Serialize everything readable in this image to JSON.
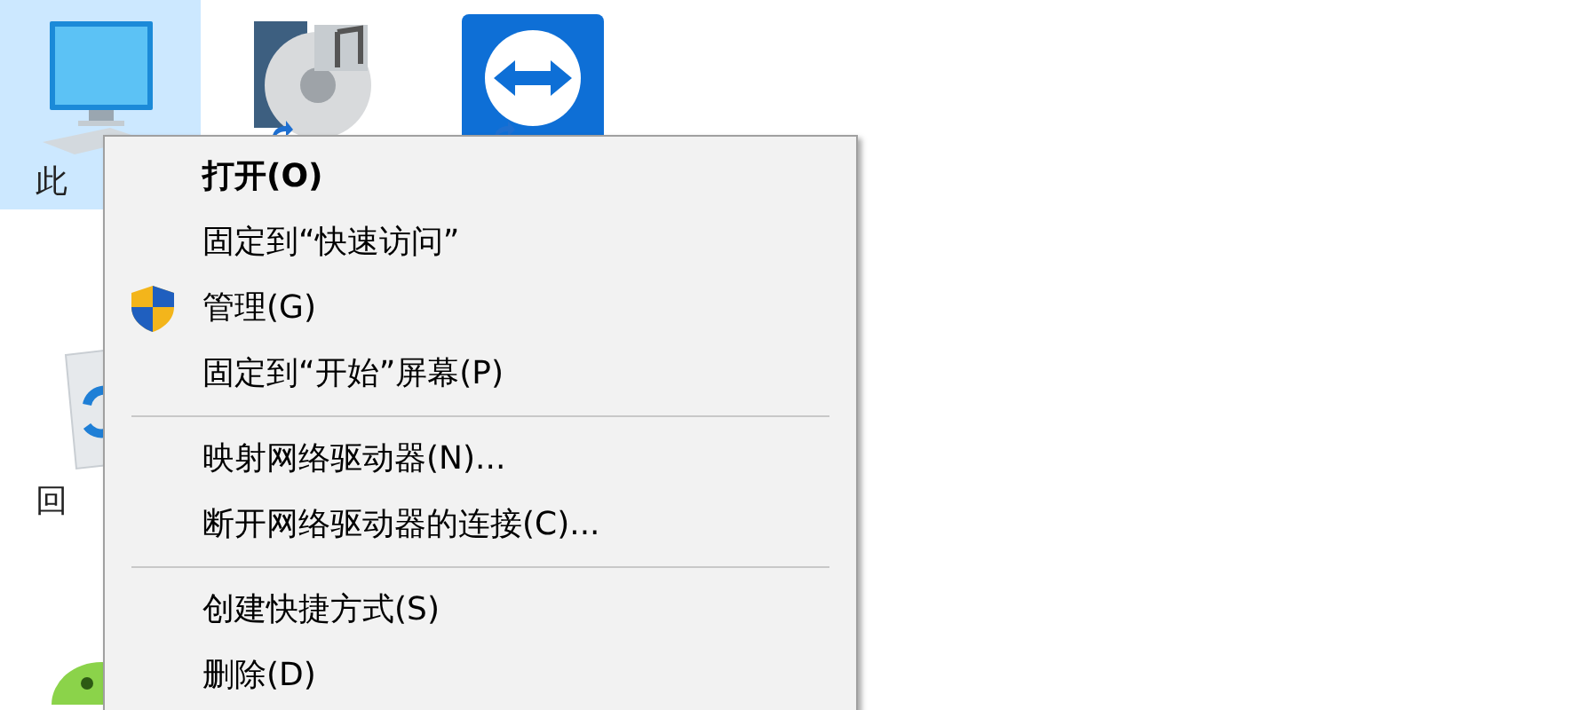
{
  "desktop_icons": [
    {
      "kind": "computer",
      "label": "此",
      "selected": true
    },
    {
      "kind": "media",
      "selected": false
    },
    {
      "kind": "remote",
      "selected": false
    },
    {
      "kind": "recycle",
      "label": "回",
      "selected": false
    },
    {
      "kind": "chat",
      "selected": false
    }
  ],
  "context_menu": {
    "items": [
      {
        "kind": "item",
        "label": "打开(O)",
        "default": true
      },
      {
        "kind": "item",
        "label": "固定到“快速访问”",
        "default": false
      },
      {
        "kind": "admin_item",
        "label": "管理(G)",
        "default": false
      },
      {
        "kind": "item",
        "label": "固定到“开始”屏幕(P)",
        "default": false
      },
      {
        "kind": "separator"
      },
      {
        "kind": "item",
        "label": "映射网络驱动器(N)...",
        "default": false
      },
      {
        "kind": "item",
        "label": "断开网络驱动器的连接(C)...",
        "default": false
      },
      {
        "kind": "separator"
      },
      {
        "kind": "item",
        "label": "创建快捷方式(S)",
        "default": false
      },
      {
        "kind": "item",
        "label": "删除(D)",
        "default": false
      }
    ]
  }
}
